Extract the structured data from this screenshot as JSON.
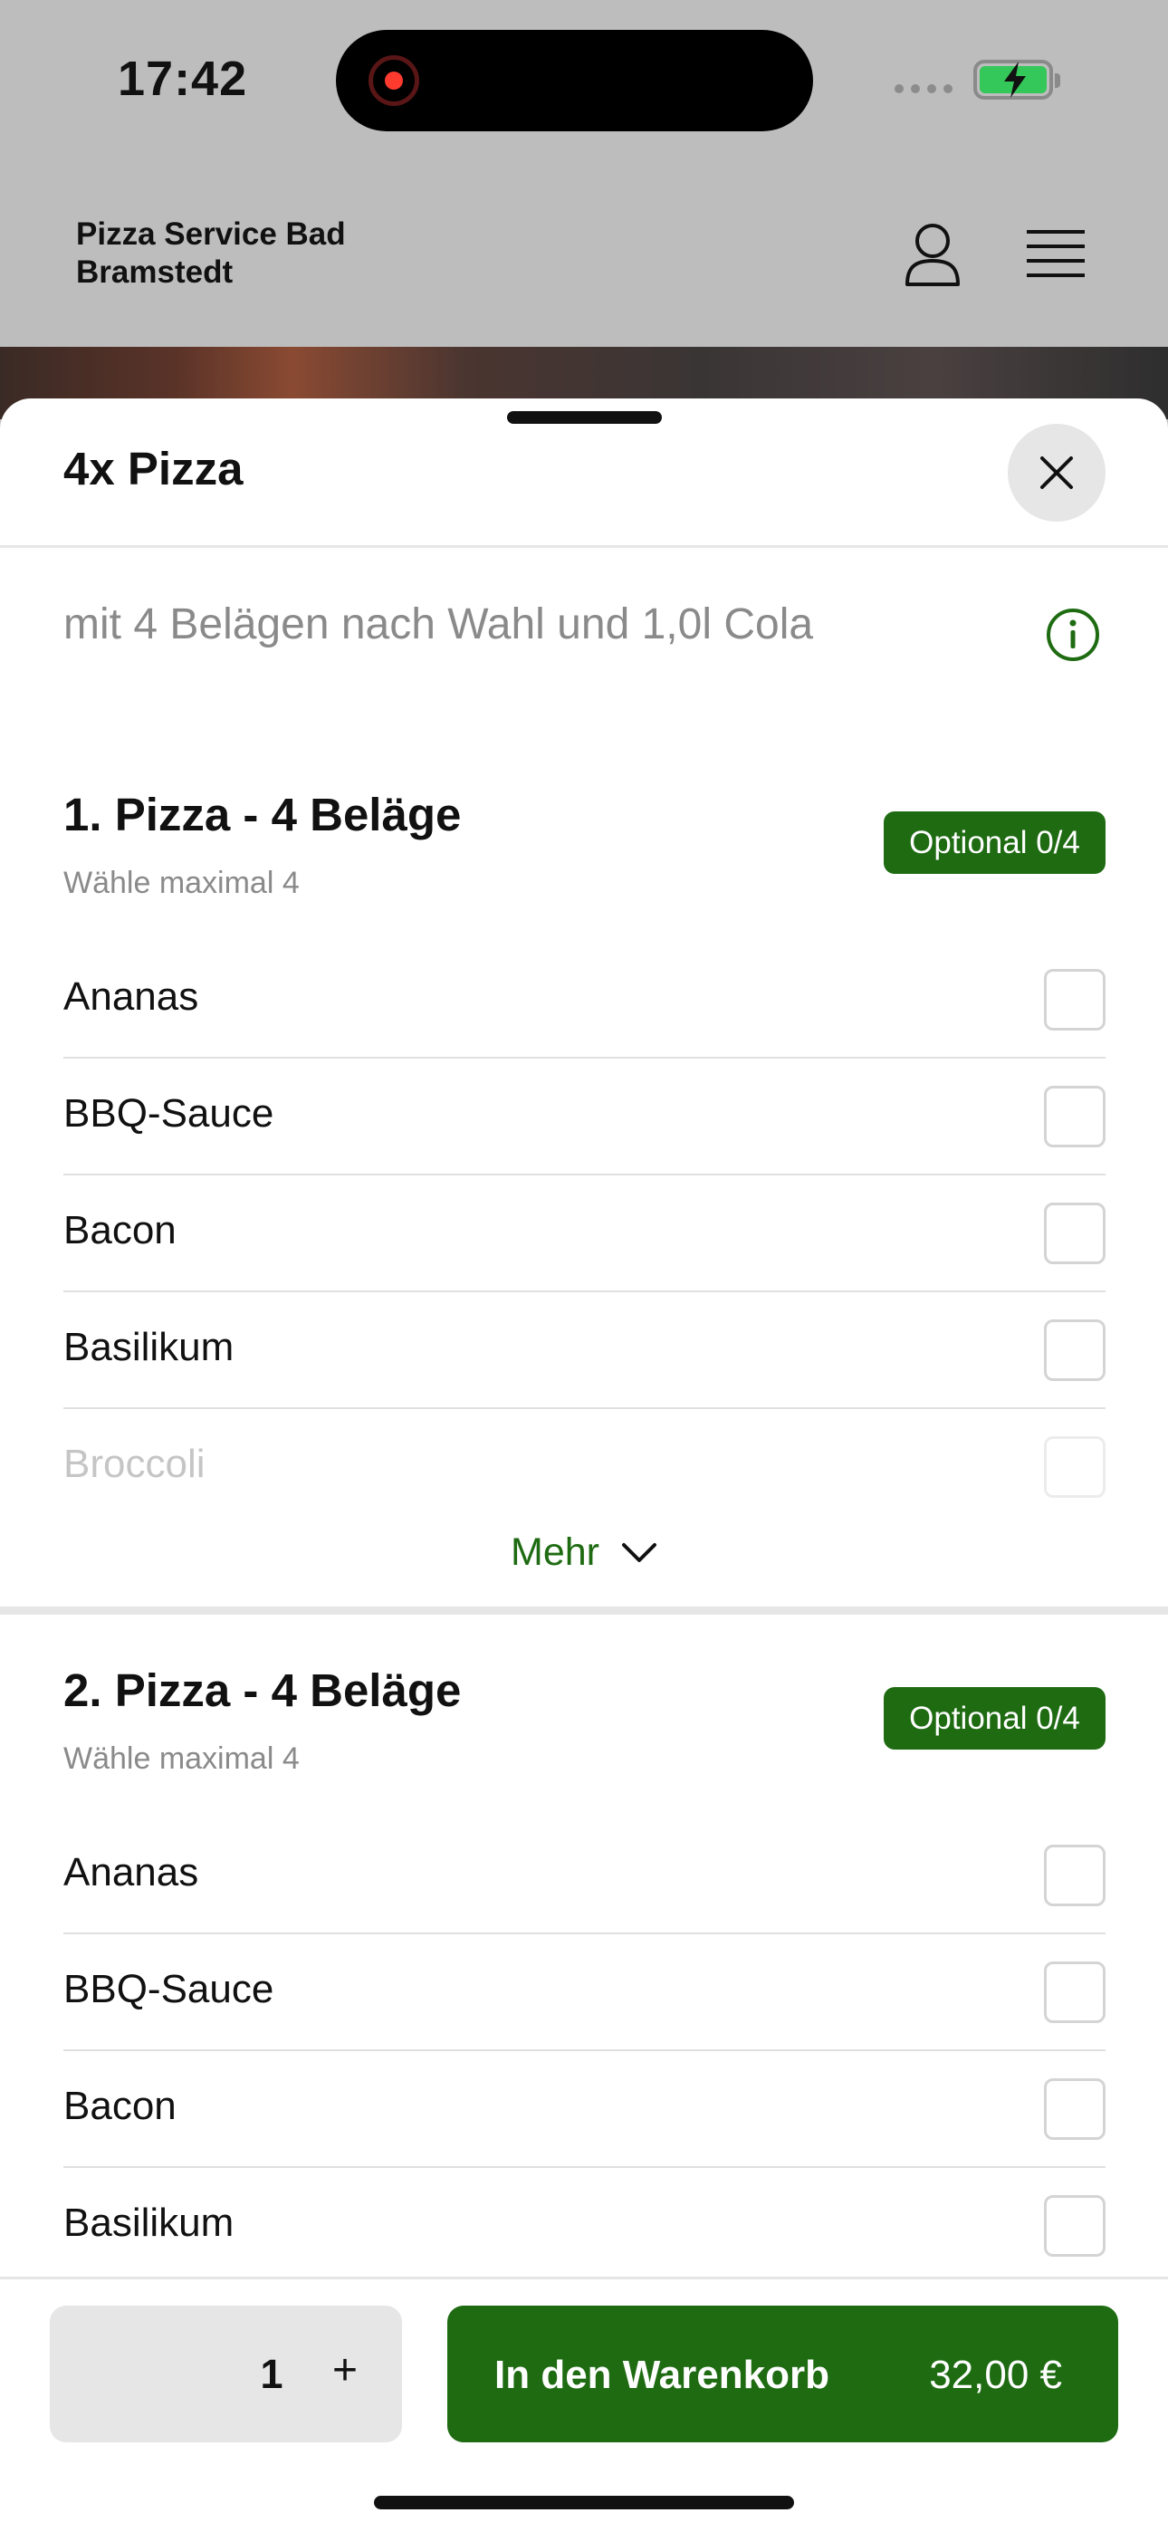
{
  "status_bar": {
    "time": "17:42"
  },
  "header": {
    "brand": "Pizza Service Bad Bramstedt"
  },
  "sheet": {
    "title": "4x Pizza",
    "description": "mit 4 Belägen nach Wahl und 1,0l Cola"
  },
  "sections": [
    {
      "title": "1. Pizza - 4 Beläge",
      "subtitle": "Wähle maximal 4",
      "badge": "Optional 0/4",
      "options": [
        "Ananas",
        "BBQ-Sauce",
        "Bacon",
        "Basilikum",
        "Broccoli"
      ],
      "more_label": "Mehr"
    },
    {
      "title": "2. Pizza - 4 Beläge",
      "subtitle": "Wähle maximal 4",
      "badge": "Optional 0/4",
      "options": [
        "Ananas",
        "BBQ-Sauce",
        "Bacon",
        "Basilikum"
      ]
    }
  ],
  "footer": {
    "quantity": "1",
    "plus": "+",
    "add_to_cart": "In den Warenkorb",
    "price": "32,00 €"
  },
  "colors": {
    "accent": "#1e6b12",
    "overlay": "#bdbdbd"
  }
}
